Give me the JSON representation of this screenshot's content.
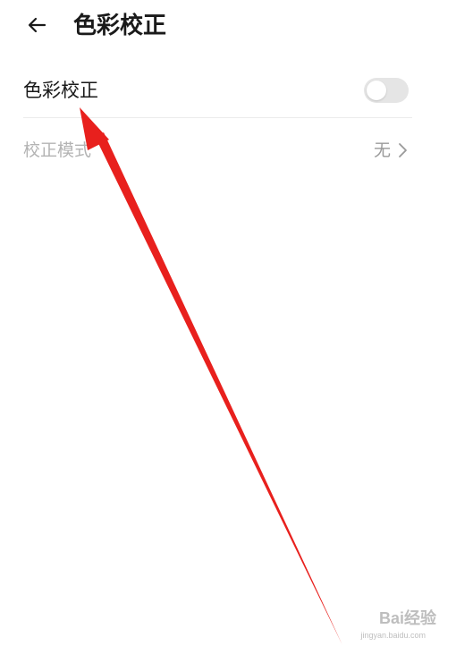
{
  "header": {
    "title": "色彩校正",
    "back_icon": "back-arrow-icon"
  },
  "settings": {
    "color_correction": {
      "label": "色彩校正",
      "enabled": false
    },
    "correction_mode": {
      "label": "校正模式",
      "value": "无",
      "chevron_icon": "chevron-right-icon"
    }
  },
  "annotation": {
    "arrow_color": "#e8201d"
  },
  "watermark": {
    "brand": "Bai经验",
    "domain": "jingyan.baidu.com"
  },
  "colors": {
    "primary_text": "#1a1a1a",
    "disabled_text": "#b3b3b3",
    "secondary_text": "#9a9a9a",
    "toggle_off": "#e5e5e5",
    "divider": "#ececec"
  }
}
